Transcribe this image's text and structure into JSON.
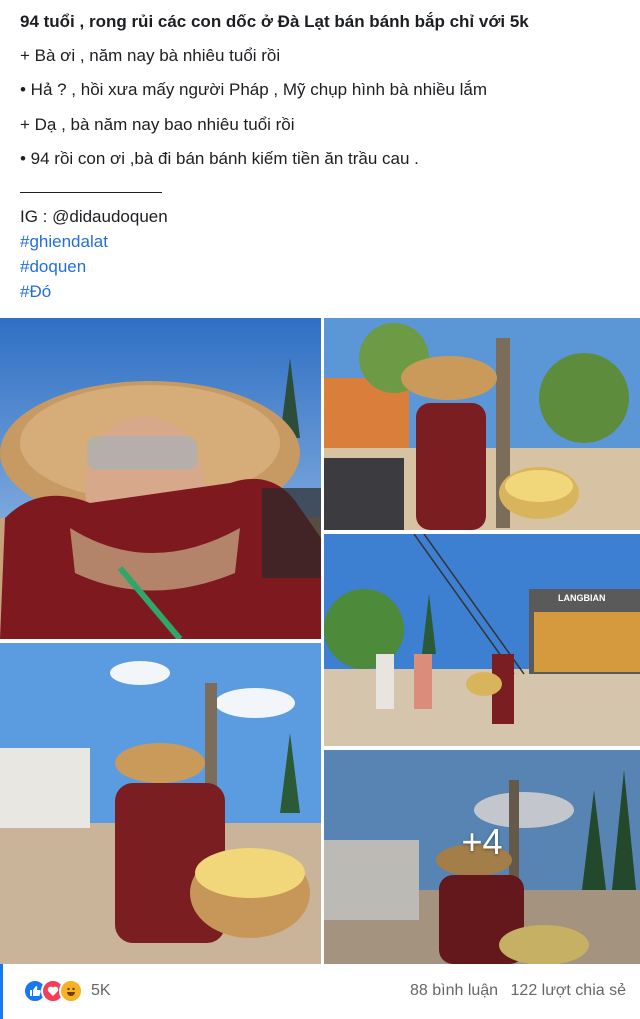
{
  "post": {
    "title": "94 tuổi , rong rủi các con dốc ở Đà Lạt bán bánh bắp chỉ với 5k",
    "lines": [
      "+ Bà ơi , năm nay bà nhiêu tuổi rồi",
      "• Hả ? , hồi xưa mấy người Pháp , Mỹ chụp hình bà nhiều lắm",
      "+ Dạ , bà năm nay bao nhiêu tuổi rồi",
      "• 94 rồi con ơi ,bà đi bán bánh kiếm tiền ăn trầu cau ."
    ],
    "instagram": "IG : @didaudoquen",
    "hashtags": [
      "#ghiendalat",
      "#doquen",
      "#Đó"
    ]
  },
  "photos": {
    "more_count": "+4",
    "shop_sign": "LANGBIAN"
  },
  "footer": {
    "reaction_icons": [
      "like-icon",
      "love-icon",
      "haha-icon"
    ],
    "reaction_count": "5K",
    "comments": "88 bình luận",
    "shares": "122 lượt chia sẻ"
  },
  "colors": {
    "hashtag": "#216fdb",
    "like": "#1877f2",
    "love": "#f33e58",
    "haha": "#f7b125"
  }
}
